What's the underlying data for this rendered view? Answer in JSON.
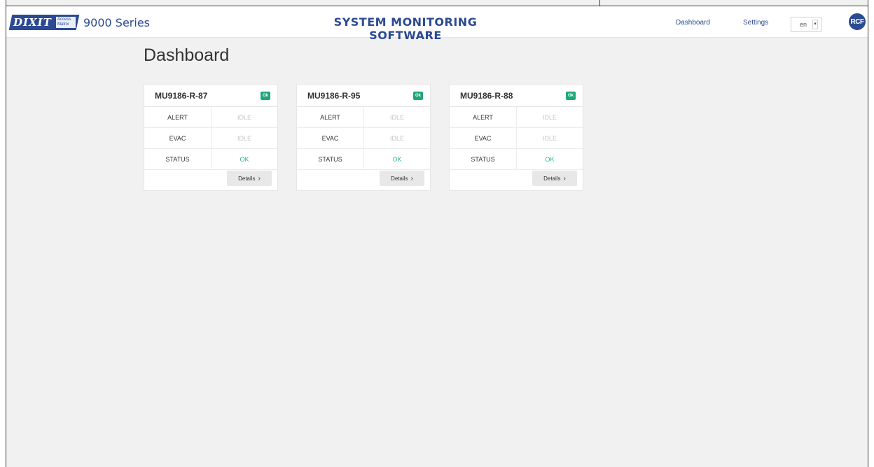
{
  "header": {
    "logo_text": "DIXIT",
    "logo_small_text": "Access Matrix",
    "series": "9000 Series",
    "title": "SYSTEM MONITORING SOFTWARE",
    "nav": {
      "dashboard": "Dashboard",
      "settings": "Settings"
    },
    "language": "en",
    "brand_logo": "RCF"
  },
  "page": {
    "title": "Dashboard"
  },
  "cards": [
    {
      "name": "MU9186-R-87",
      "badge": "Ok",
      "rows": [
        {
          "label": "ALERT",
          "value": "IDLE"
        },
        {
          "label": "EVAC",
          "value": "IDLE"
        },
        {
          "label": "STATUS",
          "value": "OK"
        }
      ],
      "details_label": "Details"
    },
    {
      "name": "MU9186-R-95",
      "badge": "Ok",
      "rows": [
        {
          "label": "ALERT",
          "value": "IDLE"
        },
        {
          "label": "EVAC",
          "value": "IDLE"
        },
        {
          "label": "STATUS",
          "value": "OK"
        }
      ],
      "details_label": "Details"
    },
    {
      "name": "MU9186-R-88",
      "badge": "Ok",
      "rows": [
        {
          "label": "ALERT",
          "value": "IDLE"
        },
        {
          "label": "EVAC",
          "value": "IDLE"
        },
        {
          "label": "STATUS",
          "value": "OK"
        }
      ],
      "details_label": "Details"
    }
  ],
  "colors": {
    "brand": "#2b4a93",
    "ok": "#1fa779",
    "idle": "#c4c4c4"
  },
  "icons": {
    "details": "chevron-right-icon",
    "select": "chevron-down-icon"
  }
}
